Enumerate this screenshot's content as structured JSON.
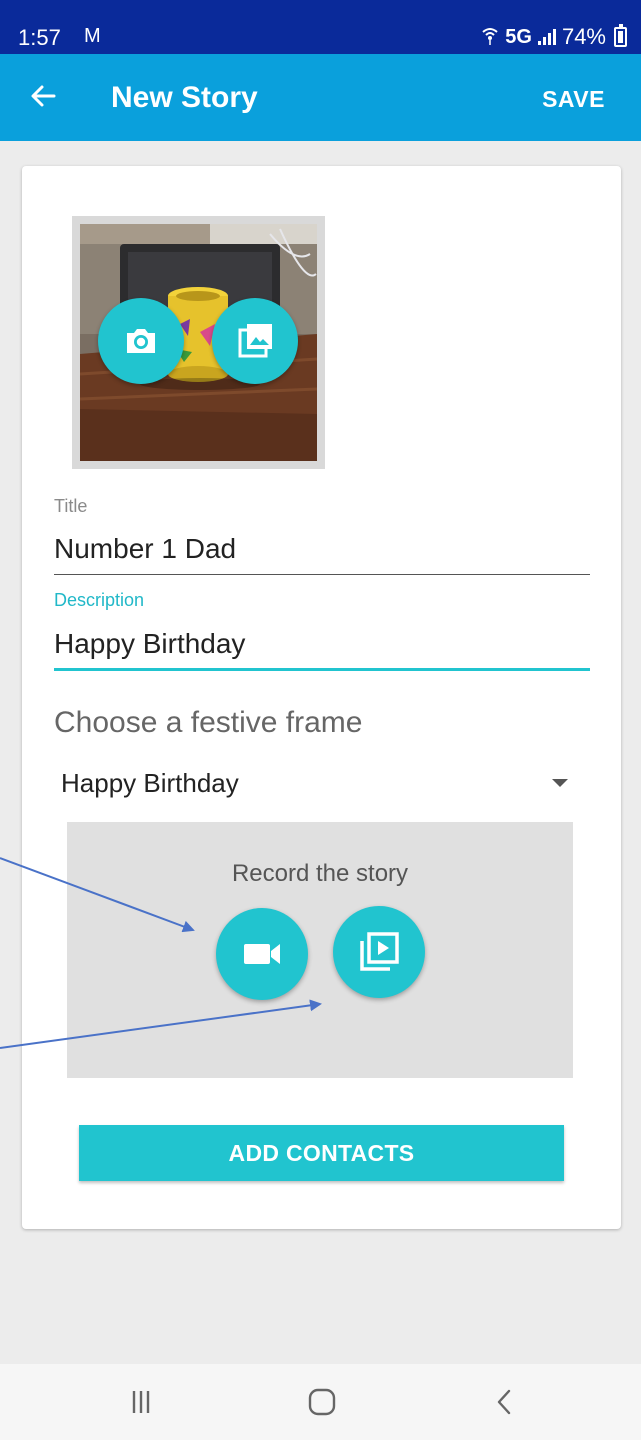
{
  "status_bar": {
    "time": "1:57",
    "mail_glyph": "M",
    "network": "5G",
    "battery": "74%",
    "battery_level": 0.74,
    "icons": [
      "mail-icon",
      "wifi-calling-icon",
      "signal-icon",
      "battery-icon"
    ]
  },
  "app_bar": {
    "back_icon": "arrow-left-icon",
    "title": "New Story",
    "save_label": "SAVE"
  },
  "photo": {
    "camera_icon": "camera-icon",
    "gallery_icon": "gallery-icon"
  },
  "form": {
    "title_label": "Title",
    "title_value": "Number 1 Dad",
    "description_label": "Description",
    "description_value": "Happy Birthday"
  },
  "frame": {
    "heading": "Choose a festive frame",
    "selected": "Happy Birthday"
  },
  "record": {
    "label": "Record the story",
    "video_icon": "video-camera-icon",
    "library_icon": "video-library-icon"
  },
  "actions": {
    "add_contacts": "ADD CONTACTS"
  },
  "nav": {
    "icons": [
      "recent-apps-icon",
      "home-icon",
      "back-icon"
    ]
  },
  "colors": {
    "status_bar": "#0a2a9a",
    "app_bar": "#0aa0dc",
    "accent": "#21c4cf",
    "annotation_arrow": "#4a72c8"
  }
}
